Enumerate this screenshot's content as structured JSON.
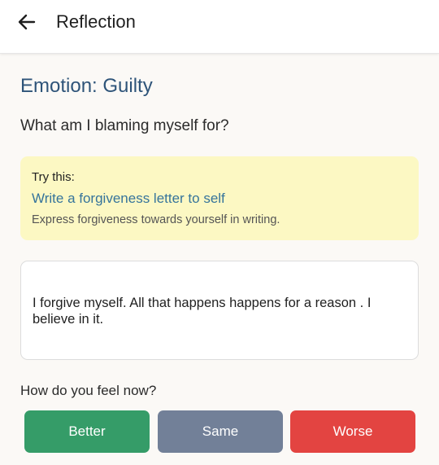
{
  "header": {
    "title": "Reflection",
    "back_icon": "arrow-left-icon"
  },
  "emotion": {
    "title": "Emotion: Guilty",
    "question": "What am I blaming myself for?"
  },
  "suggestion": {
    "label": "Try this:",
    "title": "Write a forgiveness letter to self",
    "description": "Express forgiveness towards yourself in writing."
  },
  "reflection": {
    "text": "I forgive myself. All that happens happens for a reason . I believe in it."
  },
  "feedback": {
    "prompt": "How do you feel now?",
    "better_label": "Better",
    "same_label": "Same",
    "worse_label": "Worse"
  },
  "colors": {
    "better": "#359c68",
    "same": "#728098",
    "worse": "#e34441",
    "accent_title": "#2e5479",
    "suggestion_bg": "#fcf8c3"
  }
}
